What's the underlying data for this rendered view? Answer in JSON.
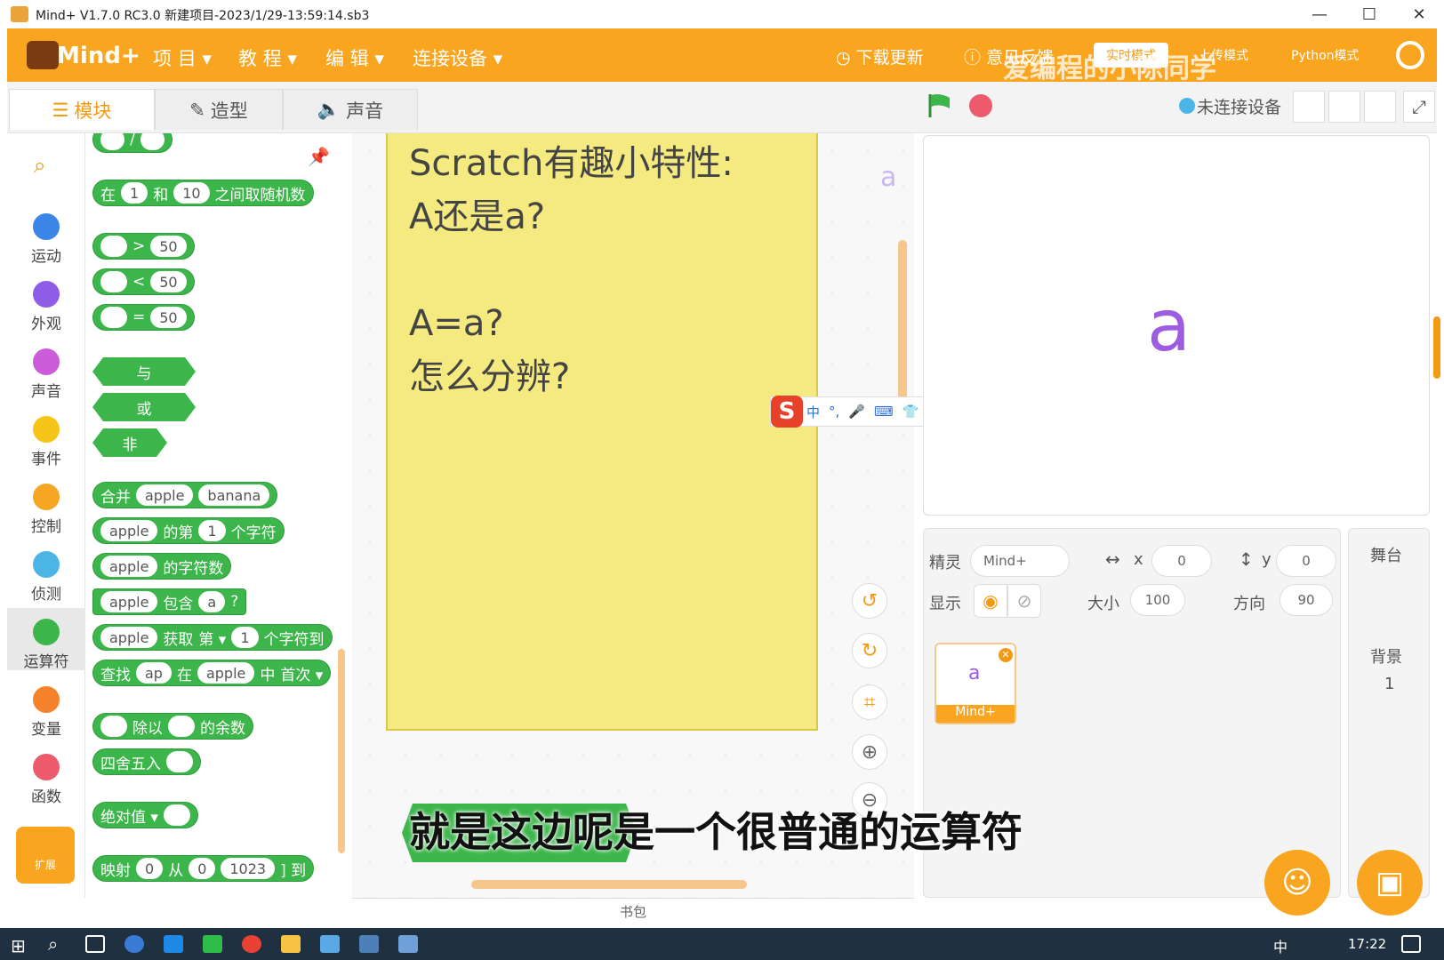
{
  "window": {
    "title": "Mind+ V1.7.0 RC3.0    新建项目-2023/1/29-13:59:14.sb3",
    "min": "—",
    "max": "☐",
    "close": "✕"
  },
  "menubar": {
    "items": [
      "项 目 ▾",
      "教 程 ▾",
      "编 辑 ▾",
      "连接设备 ▾"
    ],
    "download": "下载更新",
    "feedback": "意见反馈",
    "mode_realtime": "实时模式",
    "mode_upload": "上传模式",
    "mode_python": "Python模式",
    "watermark": "爱编程的小陈同学"
  },
  "tabs": [
    "模块",
    "造型",
    "声音"
  ],
  "connection": "未连接设备",
  "categories": [
    {
      "label": "运动",
      "color": "#3a86e8"
    },
    {
      "label": "外观",
      "color": "#8e5ce6"
    },
    {
      "label": "声音",
      "color": "#cc5bd9"
    },
    {
      "label": "事件",
      "color": "#f5c518"
    },
    {
      "label": "控制",
      "color": "#f5a623"
    },
    {
      "label": "侦测",
      "color": "#4bb5e6"
    },
    {
      "label": "运算符",
      "color": "#3cb54a"
    },
    {
      "label": "变量",
      "color": "#f5812a"
    },
    {
      "label": "函数",
      "color": "#ec5a6b"
    }
  ],
  "extension": "扩展",
  "blocks": {
    "random": {
      "a": "在",
      "from": "1",
      "b": "和",
      "to": "10",
      "c": "之间取随机数"
    },
    "gt": {
      "op": ">",
      "val": "50"
    },
    "lt": {
      "op": "<",
      "val": "50"
    },
    "eq": {
      "op": "=",
      "val": "50"
    },
    "and": "与",
    "or": "或",
    "not": "非",
    "join": {
      "label": "合并",
      "a": "apple",
      "b": "banana"
    },
    "letter": {
      "s": "apple",
      "a": "的第",
      "n": "1",
      "b": "个字符"
    },
    "length": {
      "s": "apple",
      "a": "的字符数"
    },
    "contains": {
      "s": "apple",
      "a": "包含",
      "c": "a",
      "q": "?"
    },
    "substr": {
      "s": "apple",
      "a": "获取",
      "b": "第 ▾",
      "n": "1",
      "c": "个字符到"
    },
    "find": {
      "a": "查找",
      "s": "ap",
      "b": "在",
      "t": "apple",
      "c": "中",
      "d": "首次 ▾"
    },
    "mod": {
      "a": "除以",
      "b": "的余数"
    },
    "round": "四舍五入",
    "abs": "绝对值 ▾",
    "map": {
      "a": "映射",
      "n1": "0",
      "b": "从",
      "n2": "0",
      "n3": "1023",
      "c": "] 到"
    }
  },
  "note": {
    "text": "Scratch有趣小特性:\nA还是a?\n\nA=a?\n怎么分辨?"
  },
  "ime": {
    "items": [
      "中",
      "°,",
      "🎤",
      "⌨",
      "👕",
      "▦"
    ]
  },
  "workspace_sprite_letter": "a",
  "stage_letter": "a",
  "sprite": {
    "label": "精灵",
    "name": "Mind+",
    "x_label": "x",
    "x": "0",
    "y_label": "y",
    "y": "0",
    "show_label": "显示",
    "size_label": "大小",
    "size": "100",
    "dir_label": "方向",
    "dir": "90",
    "thumb_letter": "a",
    "thumb_name": "Mind+"
  },
  "stagepane": {
    "title": "舞台",
    "bg_label": "背景",
    "bg_count": "1"
  },
  "bookbag": "书包",
  "subtitle": "就是这边呢是一个很普通的运算符",
  "taskbar": {
    "clock": "17:22",
    "lang": "中"
  }
}
